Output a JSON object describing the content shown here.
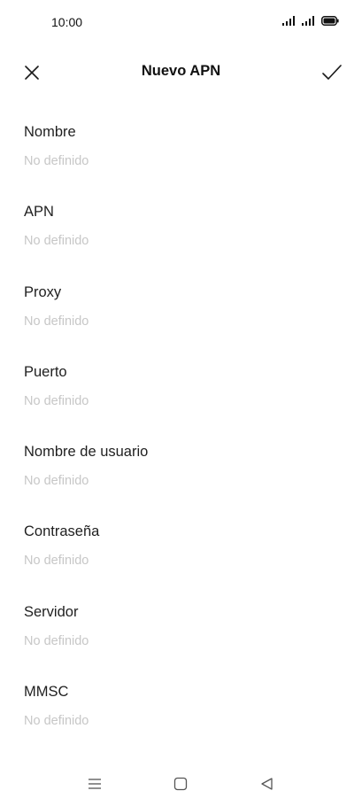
{
  "status_bar": {
    "time": "10:00"
  },
  "toolbar": {
    "title": "Nuevo APN",
    "close_icon": "close-icon",
    "confirm_icon": "check-icon"
  },
  "fields": [
    {
      "label": "Nombre",
      "value": "No definido"
    },
    {
      "label": "APN",
      "value": "No definido"
    },
    {
      "label": "Proxy",
      "value": "No definido"
    },
    {
      "label": "Puerto",
      "value": "No definido"
    },
    {
      "label": "Nombre de usuario",
      "value": "No definido"
    },
    {
      "label": "Contraseña",
      "value": "No definido"
    },
    {
      "label": "Servidor",
      "value": "No definido"
    },
    {
      "label": "MMSC",
      "value": "No definido"
    }
  ],
  "nav_bar": {
    "icons": [
      "menu-icon",
      "home-icon",
      "back-icon"
    ]
  },
  "colors": {
    "background": "#ffffff",
    "label": "#1f1f1f",
    "placeholder": "#c7c7c7"
  }
}
